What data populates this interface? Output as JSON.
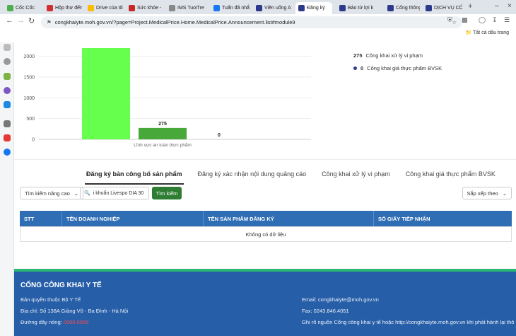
{
  "browser": {
    "tabs": [
      {
        "label": "Cốc Cốc",
        "color": "#4caf50"
      },
      {
        "label": "Hộp thư đến",
        "color": "#d32f2f"
      },
      {
        "label": "Drive của tôi",
        "color": "#fbbc04"
      },
      {
        "label": "Sức khỏe -",
        "color": "#c62828"
      },
      {
        "label": "IMS TuoiTre",
        "color": "#888888"
      },
      {
        "label": "Tuấn đã nhắ",
        "color": "#1877f2"
      },
      {
        "label": "Viên uống A",
        "color": "#2d3a8c"
      },
      {
        "label": "Đăng ký",
        "color": "#2d3a8c"
      },
      {
        "label": "Bảo tử lợi k",
        "color": "#2d3a8c"
      },
      {
        "label": "Cổng thông",
        "color": "#2d3a8c"
      },
      {
        "label": "DỊCH VỤ CÔ",
        "color": "#2d3a8c"
      }
    ],
    "url": "congkhaiyte.moh.gov.vn/?page=Project.MedicalPrice.Home.MedicalPrice.Announcement.list#module9",
    "bookmarks_label": "Tất cả dấu trang"
  },
  "chart_data": {
    "type": "bar",
    "categories": [
      "",
      "",
      ""
    ],
    "values": [
      2200,
      275,
      0
    ],
    "colors": [
      "#66ff4d",
      "#49a83a",
      "#49a83a"
    ],
    "value_labels": [
      "",
      "275",
      "0"
    ],
    "xlabel": "Lĩnh vực an toàn thực phẩm",
    "yticks": [
      "0",
      "500",
      "1000",
      "1500",
      "2000"
    ],
    "ylim": [
      0,
      2200
    ]
  },
  "legend": [
    {
      "count": "275",
      "text": "Công khai xử lý vi phạm"
    },
    {
      "count": "0",
      "text": "Công khai giá thực phẩm BVSK"
    }
  ],
  "tabs": [
    {
      "label": "Đăng ký bản công bố sản phẩm",
      "active": true
    },
    {
      "label": "Đăng ký xác nhận nội dung quảng cáo",
      "active": false
    },
    {
      "label": "Công khai xử lý vi phạm",
      "active": false
    },
    {
      "label": "Công khai giá thực phẩm BVSK",
      "active": false
    }
  ],
  "filters": {
    "advanced_label": "Tìm kiếm nâng cao",
    "search_value": "i khuẩn Livespo DIA 30",
    "search_button": "Tìm kiếm",
    "sort_label": "Sắp xếp theo"
  },
  "table": {
    "columns": [
      "STT",
      "TÊN DOANH NGHIỆP",
      "TÊN SẢN PHẨM ĐĂNG KÝ",
      "SỐ GIẤY TIẾP NHẬN"
    ],
    "empty_text": "Không có dữ liệu"
  },
  "footer": {
    "title": "CỔNG CÔNG KHAI Y TẾ",
    "copyright": "Bản quyền thuộc Bộ Y Tế",
    "address": "Địa chỉ: Số 138A Giảng Võ - Ba Đình - Hà Nội",
    "hotline_label": "Đường dây nóng:",
    "hotline_value": "0000.0000",
    "email": "Email: congkhaiyte@moh.gov.vn",
    "fax": "Fax: 0243.846.4051",
    "note": "Ghi rõ nguồn Cổng công khai y tế hoặc http://congkhaiyte.moh.gov.vn khi phát hành lại thông tin"
  }
}
